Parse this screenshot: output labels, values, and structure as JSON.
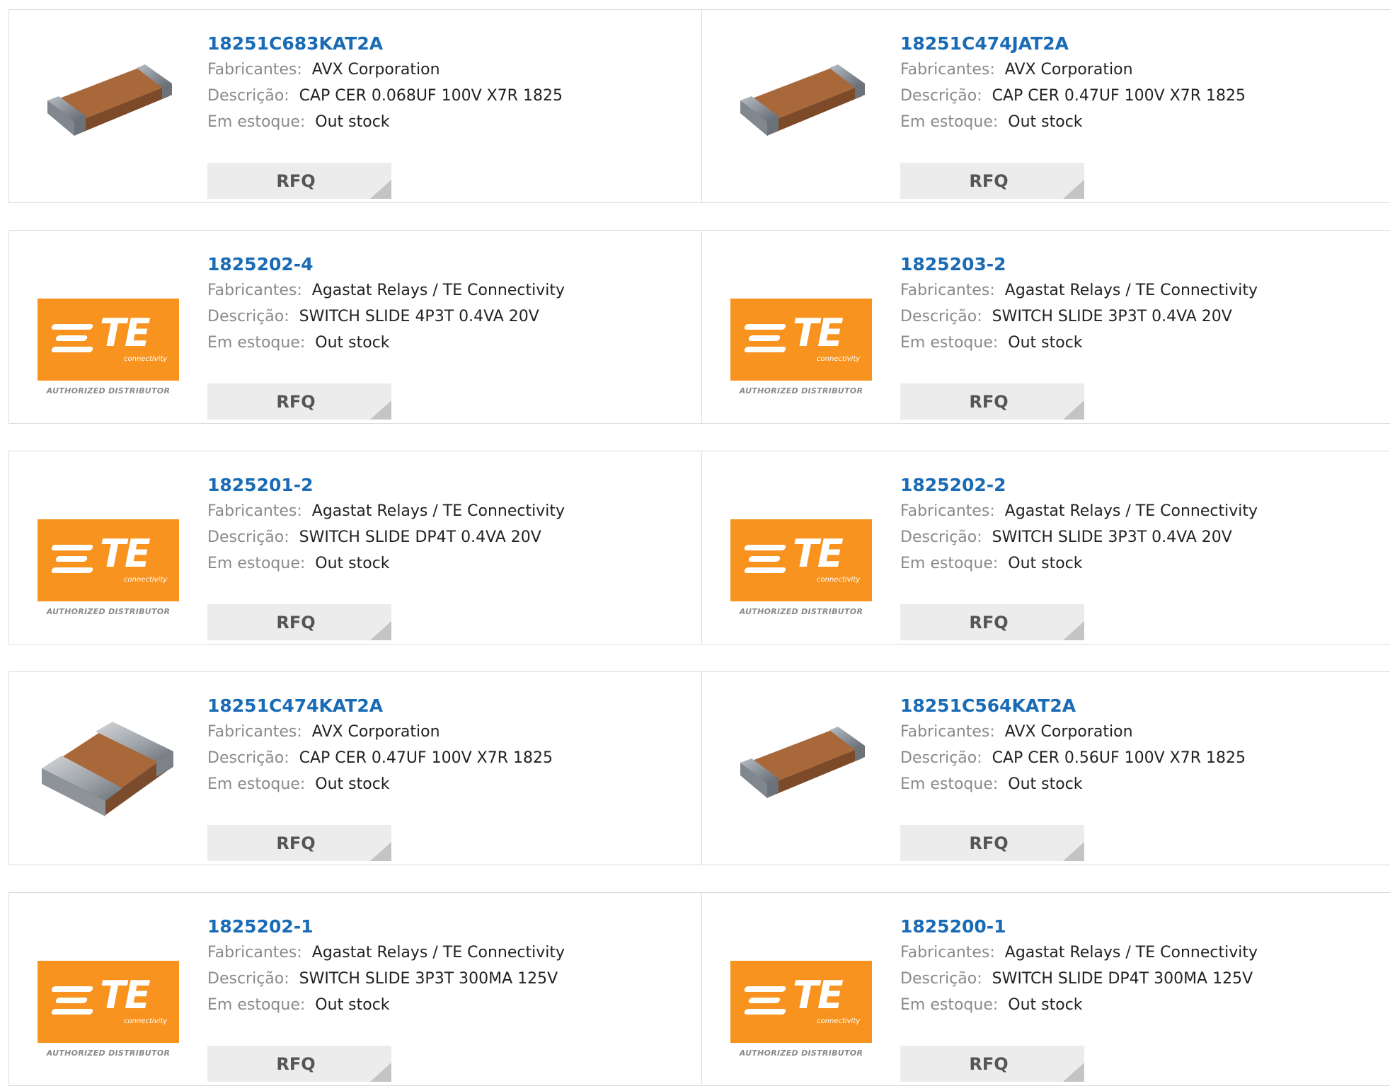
{
  "labels": {
    "manufacturer": "Fabricantes:",
    "description": "Descrição:",
    "stock": "Em estoque:",
    "rfq": "RFQ"
  },
  "te_logo": {
    "mark": "TE",
    "tagline": "connectivity",
    "caption": "AUTHORIZED DISTRIBUTOR"
  },
  "colors": {
    "part_number": "#1a6bb5",
    "te_orange": "#f7931e",
    "capacitor_body": "#a8683a",
    "capacitor_terminal": "#8a9199"
  },
  "products": [
    {
      "part": "18251C683KAT2A",
      "manufacturer": "AVX Corporation",
      "description": "CAP CER 0.068UF 100V X7R 1825",
      "stock": "Out stock",
      "image": "capacitor-flat"
    },
    {
      "part": "18251C474JAT2A",
      "manufacturer": "AVX Corporation",
      "description": "CAP CER 0.47UF 100V X7R 1825",
      "stock": "Out stock",
      "image": "capacitor-flat"
    },
    {
      "part": "1825202-4",
      "manufacturer": "Agastat Relays / TE Connectivity",
      "description": "SWITCH SLIDE 4P3T 0.4VA 20V",
      "stock": "Out stock",
      "image": "te-logo"
    },
    {
      "part": "1825203-2",
      "manufacturer": "Agastat Relays / TE Connectivity",
      "description": "SWITCH SLIDE 3P3T 0.4VA 20V",
      "stock": "Out stock",
      "image": "te-logo"
    },
    {
      "part": "1825201-2",
      "manufacturer": "Agastat Relays / TE Connectivity",
      "description": "SWITCH SLIDE DP4T 0.4VA 20V",
      "stock": "Out stock",
      "image": "te-logo"
    },
    {
      "part": "1825202-2",
      "manufacturer": "Agastat Relays / TE Connectivity",
      "description": "SWITCH SLIDE 3P3T 0.4VA 20V",
      "stock": "Out stock",
      "image": "te-logo"
    },
    {
      "part": "18251C474KAT2A",
      "manufacturer": "AVX Corporation",
      "description": "CAP CER 0.47UF 100V X7R 1825",
      "stock": "Out stock",
      "image": "capacitor-block"
    },
    {
      "part": "18251C564KAT2A",
      "manufacturer": "AVX Corporation",
      "description": "CAP CER 0.56UF 100V X7R 1825",
      "stock": "Out stock",
      "image": "capacitor-flat"
    },
    {
      "part": "1825202-1",
      "manufacturer": "Agastat Relays / TE Connectivity",
      "description": "SWITCH SLIDE 3P3T 300MA 125V",
      "stock": "Out stock",
      "image": "te-logo"
    },
    {
      "part": "1825200-1",
      "manufacturer": "Agastat Relays / TE Connectivity",
      "description": "SWITCH SLIDE DP4T 300MA 125V",
      "stock": "Out stock",
      "image": "te-logo"
    }
  ]
}
